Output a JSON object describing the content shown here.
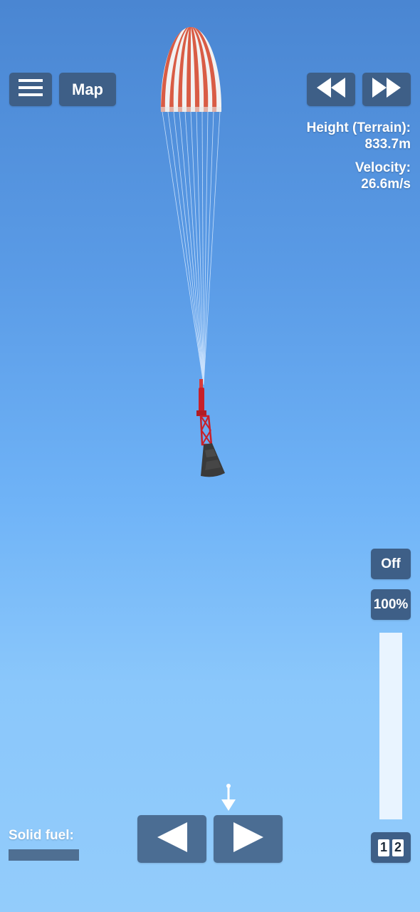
{
  "top_bar": {
    "menu_icon": "hamburger-menu-icon",
    "map_label": "Map",
    "rewind_icon": "rewind-icon",
    "fast_forward_icon": "fast-forward-icon"
  },
  "telemetry": {
    "height_label": "Height (Terrain):",
    "height_value": "833.7m",
    "velocity_label": "Velocity:",
    "velocity_value": "26.6m/s"
  },
  "throttle": {
    "off_label": "Off",
    "max_label": "100%",
    "level_fraction": 0.0
  },
  "stage": {
    "digit_1": "1",
    "digit_2": "2"
  },
  "bottom": {
    "solid_fuel_label": "Solid fuel:",
    "solid_fuel_fraction": 1.0,
    "rotate_left_icon": "triangle-left-icon",
    "rotate_right_icon": "triangle-right-icon",
    "direction_indicator_icon": "down-arrow-icon"
  },
  "colors": {
    "button_bg": "#3e5f87",
    "parachute_red": "#d95c45",
    "parachute_white": "#f2f2f2",
    "rocket_red": "#c8202a",
    "capsule": "#3a3a3a"
  }
}
